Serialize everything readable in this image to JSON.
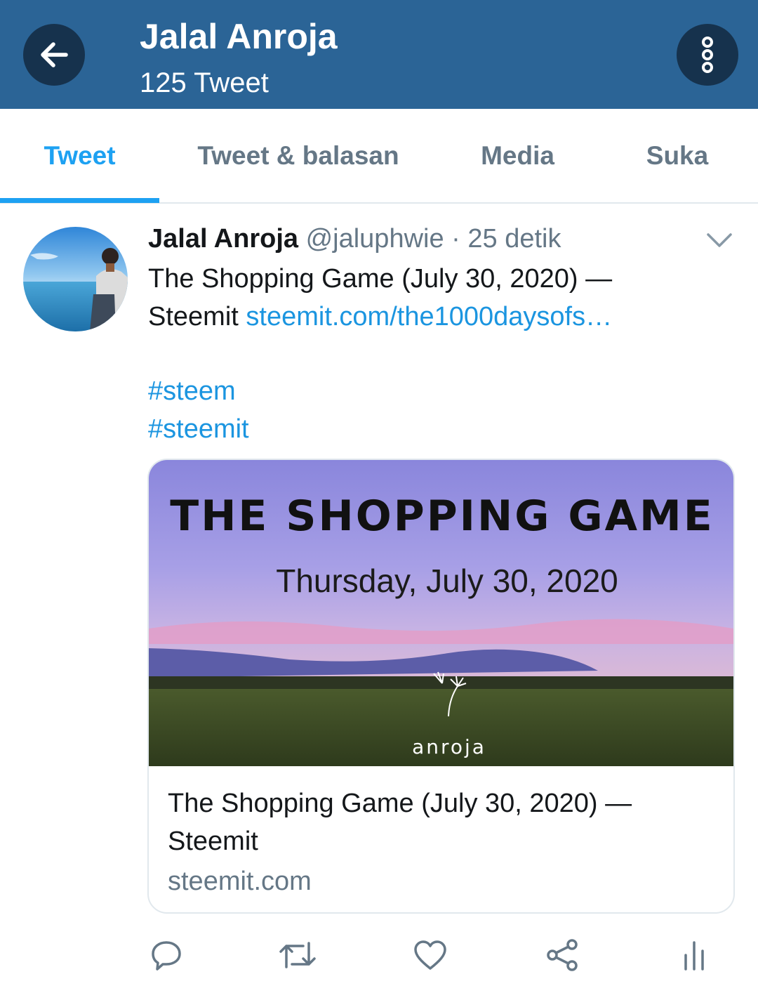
{
  "header": {
    "title": "Jalal Anroja",
    "subtitle": "125 Tweet",
    "back_icon": "arrow-left-icon",
    "more_icon": "more-vertical-icon"
  },
  "tabs": [
    {
      "label": "Tweet",
      "active": true
    },
    {
      "label": "Tweet & balasan",
      "active": false
    },
    {
      "label": "Media",
      "active": false
    },
    {
      "label": "Suka",
      "active": false
    }
  ],
  "tweet": {
    "author_name": "Jalal Anroja",
    "handle": "@jaluphwie",
    "separator": " · ",
    "time": "25 detik",
    "text_line1": "The Shopping Game (July 30, 2020) —",
    "text_line2_prefix": "Steemit ",
    "link": "steemit.com/the1000daysofs…",
    "hashtags": [
      "#steem",
      "#steemit"
    ],
    "card": {
      "image_heading": "THE SHOPPING GAME",
      "image_date": "Thursday, July 30, 2020",
      "image_logo_text": "anroja",
      "title": "The Shopping Game (July 30, 2020) — Steemit",
      "domain": "steemit.com"
    },
    "actions": [
      "reply-icon",
      "retweet-icon",
      "like-icon",
      "share-icon",
      "analytics-icon"
    ]
  },
  "colors": {
    "header_bg": "#2b6496",
    "header_button_bg": "#16324d",
    "accent": "#1da1f2",
    "link": "#1b95e0",
    "secondary_text": "#657786"
  }
}
